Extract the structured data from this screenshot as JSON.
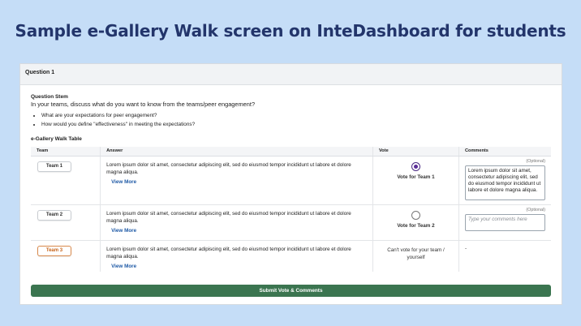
{
  "slide": {
    "title": "Sample e-Gallery Walk screen on InteDashboard for students"
  },
  "question": {
    "header": "Question 1",
    "stem_label": "Question Stem",
    "stem_text": "In your teams, discuss what do you want to know from the teams/peer engagement?",
    "bullets": [
      "What are your expectations for peer engagement?",
      "How would you define \"effectiveness\" in meeting the expectations?"
    ]
  },
  "table": {
    "title": "e-Gallery Walk Table",
    "columns": [
      "Team",
      "Answer",
      "Vote",
      "Comments"
    ],
    "rows": [
      {
        "team": "Team 1",
        "answer": "Lorem ipsum dolor sit amet, consectetur adipiscing elit, sed do eiusmod tempor incididunt ut labore et dolore magna aliqua.",
        "view_more": "View More",
        "vote_label": "Vote for Team 1",
        "vote_selected": true,
        "optional": "(Optional)",
        "comment_value": "Lorem ipsum dolor sit amet, consectetur adipiscing elit, sed do eiusmod tempor incididunt ut labore et dolore magna aliqua."
      },
      {
        "team": "Team 2",
        "answer": "Lorem ipsum dolor sit amet, consectetur adipiscing elit, sed do eiusmod tempor incididunt ut labore et dolore magna aliqua.",
        "view_more": "View More",
        "vote_label": "Vote for Team 2",
        "vote_selected": false,
        "optional": "(Optional)",
        "comment_placeholder": "Type your comments here"
      },
      {
        "team": "Team 3",
        "answer": "Lorem ipsum dolor sit amet, consectetur adipiscing elit, sed do eiusmod tempor incididunt ut labore et dolore magna aliqua.",
        "view_more": "View More",
        "cannot_vote": "Can't vote for your team / yourself",
        "comment_dash": "-"
      }
    ]
  },
  "submit_label": "Submit Vote & Comments",
  "colors": {
    "background": "#c5ddf7",
    "title": "#23356b",
    "submit": "#3b7550",
    "link": "#1f5aa6",
    "own_team": "#c7641a",
    "radio_selected": "#5b2d98"
  }
}
